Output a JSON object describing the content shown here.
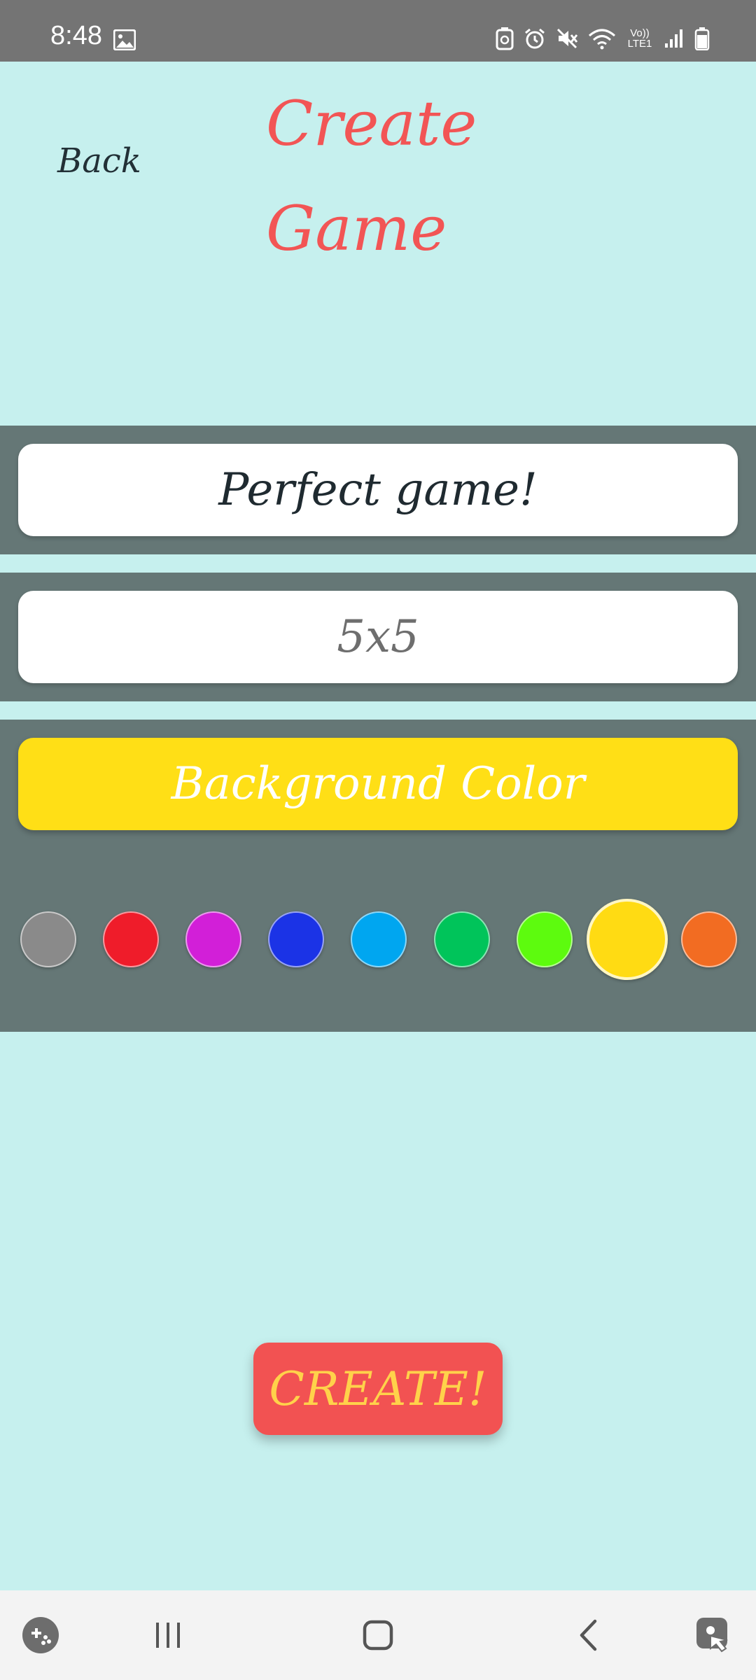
{
  "status": {
    "time": "8:48",
    "icons": [
      "image-icon",
      "battery-saver-icon",
      "alarm-icon",
      "mute-icon",
      "wifi-icon",
      "volte-icon",
      "signal-icon",
      "battery-icon"
    ],
    "volte_label": "Vo)) LTE1"
  },
  "header": {
    "back_label": "Back",
    "title_line1": "Create",
    "title_line2": "Game"
  },
  "form": {
    "game_name_value": "Perfect game!",
    "board_size_value": "5x5",
    "background_color_label": "Background Color"
  },
  "swatches": [
    {
      "name": "gray",
      "color": "#8a8a8a",
      "selected": false
    },
    {
      "name": "red",
      "color": "#ef1c2a",
      "selected": false
    },
    {
      "name": "magenta",
      "color": "#d21fd8",
      "selected": false
    },
    {
      "name": "blue",
      "color": "#1b33e6",
      "selected": false
    },
    {
      "name": "sky-blue",
      "color": "#00a6f0",
      "selected": false
    },
    {
      "name": "green",
      "color": "#00c45a",
      "selected": false
    },
    {
      "name": "lime",
      "color": "#5dfb0e",
      "selected": false
    },
    {
      "name": "yellow",
      "color": "#ffdb13",
      "selected": true
    },
    {
      "name": "orange",
      "color": "#f26c22",
      "selected": false
    }
  ],
  "actions": {
    "create_label": "CREATE!"
  },
  "colors": {
    "background": "#c6f0ee",
    "panel": "#657776",
    "accent_red": "#f25252",
    "accent_yellow": "#ffdf16"
  },
  "navbar": {
    "items": [
      "game-launcher-icon",
      "recents-icon",
      "home-icon",
      "back-icon",
      "assistant-icon"
    ]
  }
}
